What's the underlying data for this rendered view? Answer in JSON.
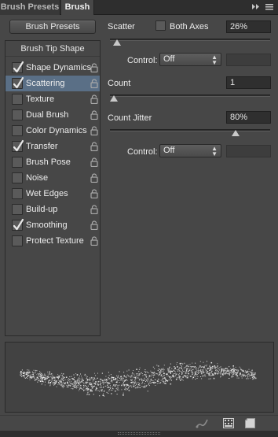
{
  "tabs": {
    "brush_presets": "Brush Presets",
    "brush": "Brush",
    "icons": [
      "double-chevron-icon",
      "menu-icon"
    ]
  },
  "brush_presets_button": "Brush Presets",
  "left_panel": {
    "tip_shape": "Brush Tip Shape",
    "items": [
      {
        "label": "Shape Dynamics",
        "checked": true
      },
      {
        "label": "Scattering",
        "checked": true,
        "selected": true
      },
      {
        "label": "Texture",
        "checked": false
      },
      {
        "label": "Dual Brush",
        "checked": false
      },
      {
        "label": "Color Dynamics",
        "checked": false
      },
      {
        "label": "Transfer",
        "checked": true
      },
      {
        "label": "Brush Pose",
        "checked": false
      },
      {
        "label": "Noise",
        "checked": false
      },
      {
        "label": "Wet Edges",
        "checked": false
      },
      {
        "label": "Build-up",
        "checked": false
      },
      {
        "label": "Smoothing",
        "checked": true
      },
      {
        "label": "Protect Texture",
        "checked": false
      }
    ]
  },
  "scatter": {
    "label": "Scatter",
    "both_axes_label": "Both Axes",
    "both_axes_checked": false,
    "value": "26%",
    "slider_percent": 2,
    "control_label": "Control:",
    "control_value": "Off"
  },
  "count": {
    "label": "Count",
    "value": "1",
    "slider_percent": 0
  },
  "count_jitter": {
    "label": "Count Jitter",
    "value": "80%",
    "slider_percent": 80,
    "control_label": "Control:",
    "control_value": "Off"
  },
  "colors": {
    "panel_bg": "#474747",
    "selected_row": "#5a6f86",
    "field_bg": "#2f2f2f",
    "tab_bar": "#2e2e2e"
  },
  "bottom_icons": [
    "brush-toggle-icon",
    "grid-icon",
    "new-preset-icon"
  ]
}
